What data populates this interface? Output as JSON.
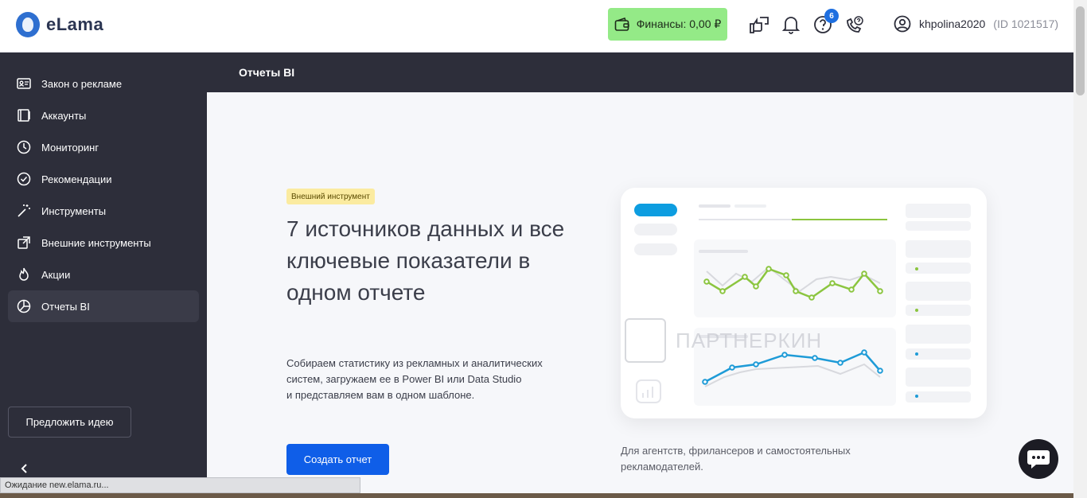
{
  "app": {
    "logo_text": "eLama"
  },
  "header": {
    "finance_label": "Финансы: 0,00 ₽",
    "help_badge_count": "6",
    "username": "khpolina2020",
    "user_id": "(ID 1021517)"
  },
  "sidebar": {
    "items": [
      {
        "label": "Закон о рекламе",
        "icon": "id-card-icon"
      },
      {
        "label": "Аккаунты",
        "icon": "accounts-icon"
      },
      {
        "label": "Мониторинг",
        "icon": "clock-icon"
      },
      {
        "label": "Рекомендации",
        "icon": "check-circle-icon"
      },
      {
        "label": "Инструменты",
        "icon": "magic-wand-icon"
      },
      {
        "label": "Внешние инструменты",
        "icon": "external-link-icon"
      },
      {
        "label": "Акции",
        "icon": "fire-icon"
      },
      {
        "label": "Отчеты BI",
        "icon": "pie-chart-icon",
        "active": true
      }
    ],
    "idea_button": "Предложить идею"
  },
  "page": {
    "title": "Отчеты BI",
    "tag": "Внешний инструмент",
    "headline": "7 источников данных и все ключевые показатели в одном отчете",
    "description": {
      "line1": "Собираем статистику из рекламных и аналитических",
      "line2": "систем, загружаем ее в Power BI или Data Studio",
      "line3": "и представляем вам в одном шаблоне."
    },
    "create_button": "Создать отчет",
    "note": "Для агентств, фрилансеров и самостоятельных рекламодателей."
  },
  "watermark": "ПАРТНЕРКИН",
  "status_bar": "Ожидание new.elama.ru...",
  "colors": {
    "sidebar_bg": "#2d2e3a",
    "finance_bg": "#94ea87",
    "primary": "#0f5ee8",
    "tag_bg": "#fbeba0",
    "chart_green": "#8bc53f",
    "chart_blue": "#1e9bd7"
  }
}
